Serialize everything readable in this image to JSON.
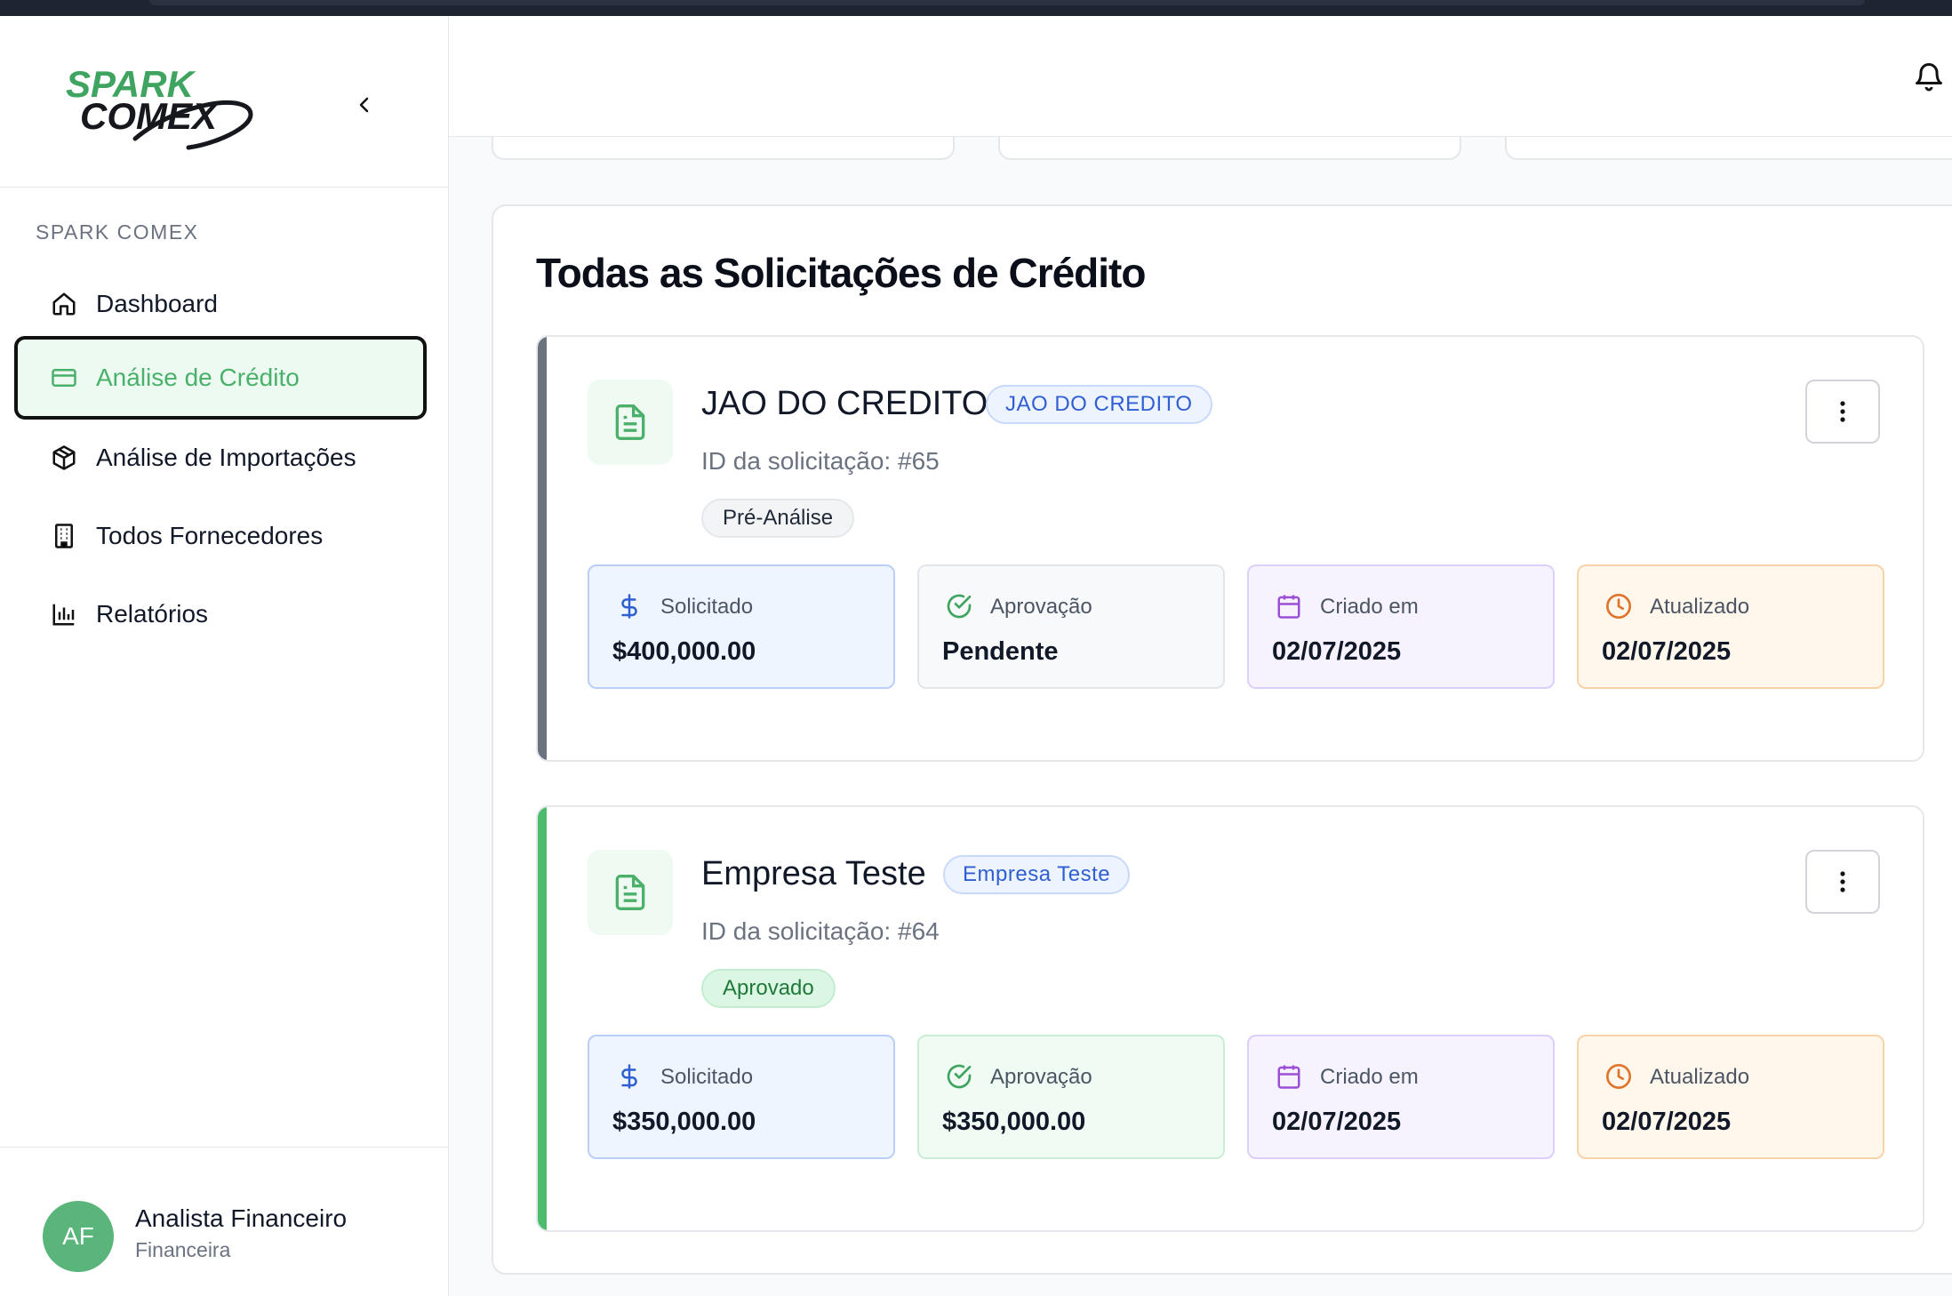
{
  "app": {
    "logo_line1": "SPARK",
    "logo_line2": "COMEX"
  },
  "sidebar": {
    "section_label": "SPARK COMEX",
    "items": [
      {
        "label": "Dashboard",
        "icon": "home-icon"
      },
      {
        "label": "Análise de Crédito",
        "icon": "credit-card-icon",
        "active": true
      },
      {
        "label": "Análise de Importações",
        "icon": "package-icon"
      },
      {
        "label": "Todos Fornecedores",
        "icon": "building-icon"
      },
      {
        "label": "Relatórios",
        "icon": "bar-chart-icon"
      }
    ],
    "user": {
      "initials": "AF",
      "name": "Analista Financeiro",
      "role": "Financeira"
    }
  },
  "main": {
    "title": "Todas as Solicitações de Crédito",
    "requests": [
      {
        "name": "JAO DO CREDITO",
        "tag": "JAO DO CREDITO",
        "id_text": "ID da solicitação: #65",
        "status": "Pré-Análise",
        "accent_color": "#6b7280",
        "metrics": {
          "requested": {
            "label": "Solicitado",
            "value": "$400,000.00"
          },
          "approval": {
            "label": "Aprovação",
            "value": "Pendente"
          },
          "created": {
            "label": "Criado em",
            "value": "02/07/2025"
          },
          "updated": {
            "label": "Atualizado",
            "value": "02/07/2025"
          }
        }
      },
      {
        "name": "Empresa Teste",
        "tag": "Empresa Teste",
        "id_text": "ID da solicitação: #64",
        "status": "Aprovado",
        "accent_color": "#4cbc6c",
        "metrics": {
          "requested": {
            "label": "Solicitado",
            "value": "$350,000.00"
          },
          "approval": {
            "label": "Aprovação",
            "value": "$350,000.00"
          },
          "created": {
            "label": "Criado em",
            "value": "02/07/2025"
          },
          "updated": {
            "label": "Atualizado",
            "value": "02/07/2025"
          }
        }
      }
    ]
  },
  "colors": {
    "brand_green": "#3fa45f",
    "active_bg": "#edfaf2",
    "tag_blue": "#2f5fd0"
  }
}
